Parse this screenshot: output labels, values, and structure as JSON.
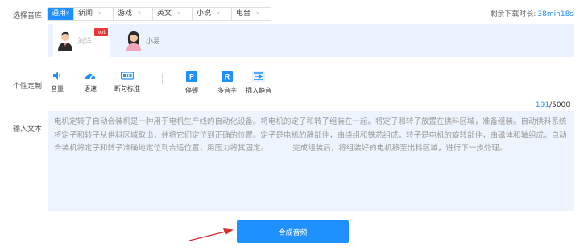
{
  "library": {
    "label": "选择音库",
    "tabs": [
      {
        "label": "通用",
        "active": true
      },
      {
        "label": "新闻",
        "active": false
      },
      {
        "label": "游戏",
        "active": false
      },
      {
        "label": "英文",
        "active": false
      },
      {
        "label": "小说",
        "active": false
      },
      {
        "label": "电台",
        "active": false
      }
    ],
    "remaining_label": "剩余下载时长:",
    "remaining_value": "38min18s",
    "voices": [
      {
        "name": "刘洋",
        "badge": "hot",
        "selected": true
      },
      {
        "name": "小易",
        "selected": false
      }
    ]
  },
  "custom": {
    "label": "个性定制",
    "tools": [
      {
        "label": "音量",
        "icon": "volume-icon"
      },
      {
        "label": "语速",
        "icon": "speed-icon"
      },
      {
        "label": "断句标准",
        "icon": "sentence-break-icon"
      },
      {
        "label": "停顿",
        "icon": "pause-icon"
      },
      {
        "label": "多音字",
        "icon": "polyphone-icon"
      },
      {
        "label": "插入静音",
        "icon": "insert-silence-icon"
      }
    ]
  },
  "counter": {
    "current": "191",
    "max": "/5000"
  },
  "input": {
    "label": "输入文本",
    "text": "电机定转子自动合装机是一种用于电机生产线的自动化设备。将电机的定子和转子组装在一起。将定子和转子放置在供料区域，准备组装。自动供料系统将定子和转子从供料区域取出，并将它们定位到正确的位置。定子是电机的静部件，由绕组和铁芯组成。转子是电机的旋转部件，由磁体和轴组成。自动合装机将定子和转子准确地定位到合适位置，用压力将其固定。          完成组装后，将组装好的电机移至出料区域，进行下一步处理。"
  },
  "submit_label": "合成音频",
  "colors": {
    "accent": "#1e90ff",
    "panel": "#eaf3fe",
    "hot": "#e53935",
    "arrow": "#d32f2f"
  }
}
